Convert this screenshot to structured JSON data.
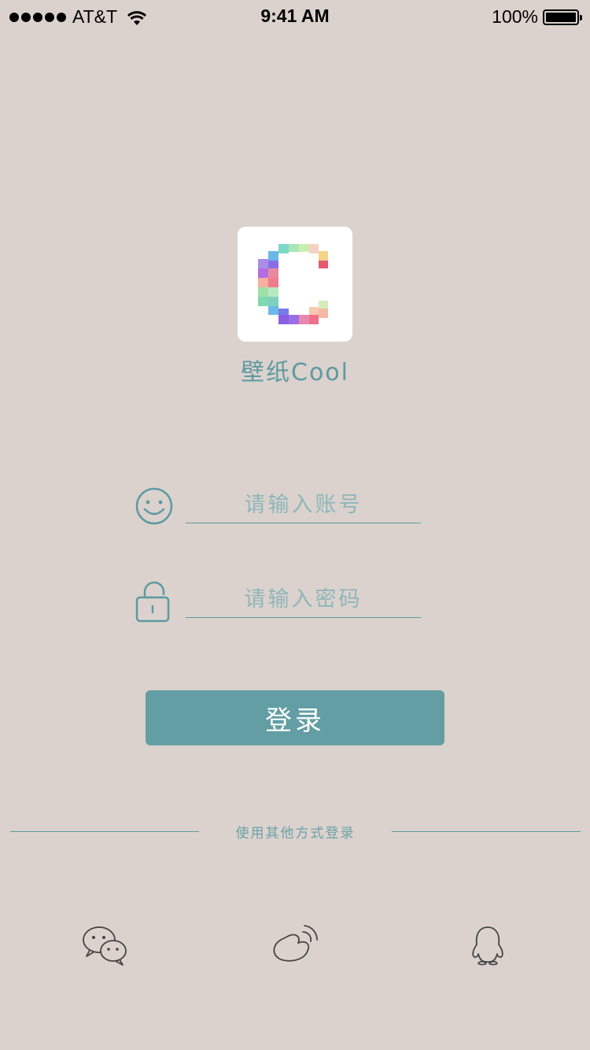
{
  "status_bar": {
    "carrier": "AT&T",
    "time": "9:41 AM",
    "battery": "100%"
  },
  "app": {
    "name": "壁纸Cool",
    "logo_icon": "pixel-c-logo-icon"
  },
  "form": {
    "account_placeholder": "请输入账号",
    "account_icon": "smiley-icon",
    "password_placeholder": "请输入密码",
    "password_icon": "unlock-icon",
    "login_label": "登录"
  },
  "other_login": {
    "label": "使用其他方式登录",
    "providers": [
      {
        "icon": "wechat-icon"
      },
      {
        "icon": "weibo-icon"
      },
      {
        "icon": "qq-icon"
      }
    ]
  },
  "colors": {
    "background": "#dbd2cd",
    "accent": "#629ea4",
    "text_accent": "#5e9aa1"
  }
}
